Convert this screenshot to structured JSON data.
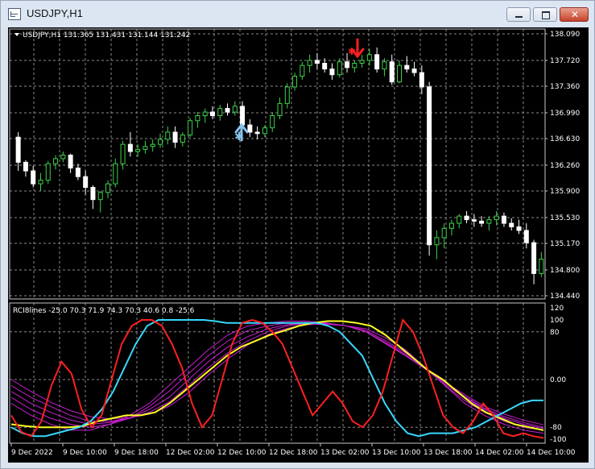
{
  "window": {
    "title": "USDJPY,H1",
    "icon": "chart-window-icon",
    "buttons": {
      "minimize": "minimize-icon",
      "maximize": "maximize-icon",
      "close": "close-icon"
    }
  },
  "main_chart": {
    "info": "USDJPY,H1  131.365 131.431 131.144 131.242",
    "price_labels": [
      "138.090",
      "137.720",
      "137.360",
      "136.990",
      "136.630",
      "136.260",
      "135.900",
      "135.530",
      "135.170",
      "134.800",
      "134.440"
    ],
    "up_candle_color": "#3dd24a",
    "down_candle_color": "#ffffff",
    "buy_arrow_color": "#86c3ea",
    "sell_arrow_color": "#ff1f1f"
  },
  "indicator": {
    "info": "RCI8lines -25.0 70.3 71.9 74.3 70.3 40.6 0.8 -25.6",
    "scale_labels": [
      "120",
      "100",
      "80",
      "0.00",
      "-80",
      "-100"
    ]
  },
  "time_axis": {
    "labels": [
      "9 Dec 2022",
      "9 Dec 10:00",
      "9 Dec 18:00",
      "12 Dec 02:00",
      "12 Dec 10:00",
      "12 Dec 18:00",
      "13 Dec 02:00",
      "13 Dec 10:00",
      "13 Dec 18:00",
      "14 Dec 02:00",
      "14 Dec 10:00"
    ]
  },
  "chart_data": [
    {
      "type": "candlestick",
      "title": "USDJPY,H1",
      "ylim": [
        134.44,
        138.09
      ],
      "ohlc": [
        [
          136.65,
          136.72,
          136.18,
          136.3
        ],
        [
          136.3,
          136.33,
          136.1,
          136.18
        ],
        [
          136.18,
          136.25,
          135.95,
          136.0
        ],
        [
          136.0,
          136.15,
          135.9,
          136.05
        ],
        [
          136.05,
          136.32,
          136.0,
          136.28
        ],
        [
          136.28,
          136.4,
          136.2,
          136.35
        ],
        [
          136.35,
          136.45,
          136.3,
          136.4
        ],
        [
          136.4,
          136.42,
          136.15,
          136.22
        ],
        [
          136.22,
          136.28,
          136.05,
          136.1
        ],
        [
          136.1,
          136.18,
          135.85,
          135.95
        ],
        [
          135.95,
          135.98,
          135.65,
          135.78
        ],
        [
          135.78,
          135.9,
          135.6,
          135.88
        ],
        [
          135.88,
          136.05,
          135.8,
          136.0
        ],
        [
          136.0,
          136.35,
          135.95,
          136.28
        ],
        [
          136.28,
          136.6,
          136.2,
          136.55
        ],
        [
          136.55,
          136.72,
          136.38,
          136.45
        ],
        [
          136.45,
          136.55,
          136.38,
          136.48
        ],
        [
          136.48,
          136.6,
          136.42,
          136.52
        ],
        [
          136.52,
          136.62,
          136.45,
          136.55
        ],
        [
          136.55,
          136.7,
          136.5,
          136.62
        ],
        [
          136.62,
          136.8,
          136.55,
          136.72
        ],
        [
          136.72,
          136.8,
          136.5,
          136.58
        ],
        [
          136.58,
          136.72,
          136.52,
          136.68
        ],
        [
          136.68,
          136.92,
          136.65,
          136.88
        ],
        [
          136.88,
          137.0,
          136.78,
          136.95
        ],
        [
          136.95,
          137.05,
          136.85,
          137.0
        ],
        [
          137.0,
          137.08,
          136.9,
          136.95
        ],
        [
          136.95,
          137.1,
          136.88,
          137.05
        ],
        [
          137.05,
          137.12,
          136.95,
          137.0
        ],
        [
          137.0,
          137.15,
          136.95,
          137.08
        ],
        [
          137.08,
          137.15,
          136.78,
          136.82
        ],
        [
          136.82,
          136.9,
          136.65,
          136.72
        ],
        [
          136.72,
          136.8,
          136.62,
          136.7
        ],
        [
          136.7,
          136.82,
          136.65,
          136.78
        ],
        [
          136.78,
          137.0,
          136.72,
          136.95
        ],
        [
          136.95,
          137.2,
          136.9,
          137.12
        ],
        [
          137.12,
          137.4,
          137.05,
          137.35
        ],
        [
          137.35,
          137.55,
          137.3,
          137.5
        ],
        [
          137.5,
          137.7,
          137.45,
          137.65
        ],
        [
          137.65,
          137.8,
          137.55,
          137.72
        ],
        [
          137.72,
          137.82,
          137.6,
          137.68
        ],
        [
          137.68,
          137.75,
          137.55,
          137.6
        ],
        [
          137.6,
          137.68,
          137.45,
          137.52
        ],
        [
          137.52,
          137.75,
          137.48,
          137.7
        ],
        [
          137.7,
          137.82,
          137.55,
          137.62
        ],
        [
          137.62,
          137.72,
          137.55,
          137.68
        ],
        [
          137.68,
          137.8,
          137.62,
          137.72
        ],
        [
          137.72,
          137.88,
          137.65,
          137.8
        ],
        [
          137.8,
          137.9,
          137.55,
          137.6
        ],
        [
          137.6,
          137.75,
          137.5,
          137.7
        ],
        [
          137.7,
          137.8,
          137.38,
          137.42
        ],
        [
          137.42,
          137.72,
          137.4,
          137.65
        ],
        [
          137.65,
          137.78,
          137.55,
          137.6
        ],
        [
          137.6,
          137.7,
          137.5,
          137.55
        ],
        [
          137.55,
          137.65,
          137.25,
          137.35
        ],
        [
          137.35,
          137.42,
          135.0,
          135.15
        ],
        [
          135.15,
          135.35,
          134.95,
          135.25
        ],
        [
          135.25,
          135.45,
          135.1,
          135.38
        ],
        [
          135.38,
          135.5,
          135.28,
          135.45
        ],
        [
          135.45,
          135.58,
          135.38,
          135.55
        ],
        [
          135.55,
          135.62,
          135.45,
          135.5
        ],
        [
          135.5,
          135.58,
          135.4,
          135.48
        ],
        [
          135.48,
          135.55,
          135.4,
          135.45
        ],
        [
          135.45,
          135.55,
          135.35,
          135.5
        ],
        [
          135.5,
          135.62,
          135.42,
          135.55
        ],
        [
          135.55,
          135.6,
          135.4,
          135.45
        ],
        [
          135.45,
          135.52,
          135.35,
          135.4
        ],
        [
          135.4,
          135.5,
          135.3,
          135.35
        ],
        [
          135.35,
          135.45,
          135.1,
          135.18
        ],
        [
          135.18,
          135.22,
          134.6,
          134.75
        ],
        [
          134.75,
          135.05,
          134.7,
          134.95
        ]
      ]
    },
    {
      "type": "line",
      "title": "RCI8lines",
      "ylim": [
        -100,
        120
      ],
      "series": [
        {
          "color": "#ff2020",
          "values": [
            -60,
            -88,
            -95,
            -70,
            -10,
            30,
            10,
            -50,
            -80,
            -60,
            0,
            60,
            90,
            100,
            100,
            90,
            60,
            20,
            -40,
            -80,
            -60,
            0,
            60,
            95,
            100,
            95,
            80,
            60,
            20,
            -20,
            -60,
            -40,
            -20,
            -40,
            -70,
            -80,
            -60,
            -20,
            40,
            100,
            80,
            40,
            -10,
            -60,
            -80,
            -90,
            -70,
            -40,
            -60,
            -90,
            -95,
            -90,
            -95,
            -98
          ]
        },
        {
          "color": "#39d8ff",
          "values": [
            -80,
            -90,
            -95,
            -95,
            -90,
            -85,
            -80,
            -70,
            -50,
            -20,
            20,
            60,
            90,
            100,
            100,
            100,
            100,
            100,
            98,
            95,
            95,
            95,
            95,
            95,
            95,
            95,
            95,
            95,
            90,
            80,
            60,
            40,
            0,
            -40,
            -70,
            -90,
            -95,
            -90,
            -90,
            -90,
            -85,
            -80,
            -70,
            -60,
            -50,
            -40,
            -35,
            -35
          ]
        },
        {
          "color": "#ffff22",
          "values": [
            -75,
            -78,
            -80,
            -80,
            -80,
            -78,
            -70,
            -65,
            -60,
            -60,
            -55,
            -40,
            -20,
            0,
            20,
            40,
            55,
            65,
            75,
            82,
            90,
            95,
            98,
            98,
            95,
            90,
            75,
            55,
            35,
            15,
            0,
            -20,
            -40,
            -55,
            -65,
            -75,
            -80,
            -85
          ]
        },
        {
          "color": "#c81ecf",
          "values": [
            -40,
            -60,
            -75,
            -85,
            -85,
            -75,
            -60,
            -40,
            -10,
            20,
            50,
            75,
            90,
            95,
            98,
            98,
            95,
            90,
            85,
            70,
            50,
            20,
            -10,
            -40,
            -60,
            -75,
            -85,
            -90
          ]
        },
        {
          "color": "#c81ecf",
          "values": [
            -30,
            -50,
            -65,
            -75,
            -80,
            -75,
            -65,
            -45,
            -20,
            10,
            40,
            65,
            82,
            90,
            95,
            96,
            94,
            90,
            82,
            65,
            45,
            20,
            -10,
            -35,
            -55,
            -70,
            -80,
            -85
          ]
        },
        {
          "color": "#c81ecf",
          "values": [
            -20,
            -40,
            -55,
            -68,
            -75,
            -72,
            -65,
            -50,
            -30,
            0,
            30,
            55,
            72,
            85,
            92,
            95,
            94,
            90,
            80,
            62,
            42,
            18,
            -8,
            -30,
            -50,
            -65,
            -75,
            -82
          ]
        },
        {
          "color": "#c81ecf",
          "values": [
            -10,
            -30,
            -45,
            -60,
            -70,
            -70,
            -65,
            -55,
            -38,
            -10,
            20,
            45,
            65,
            80,
            90,
            94,
            94,
            90,
            80,
            60,
            40,
            18,
            -5,
            -28,
            -48,
            -62,
            -72,
            -80
          ]
        },
        {
          "color": "#c81ecf",
          "values": [
            0,
            -20,
            -38,
            -52,
            -62,
            -66,
            -64,
            -58,
            -45,
            -22,
            8,
            35,
            58,
            75,
            86,
            92,
            93,
            90,
            80,
            60,
            40,
            18,
            -5,
            -25,
            -45,
            -58,
            -68,
            -76
          ]
        }
      ]
    }
  ]
}
